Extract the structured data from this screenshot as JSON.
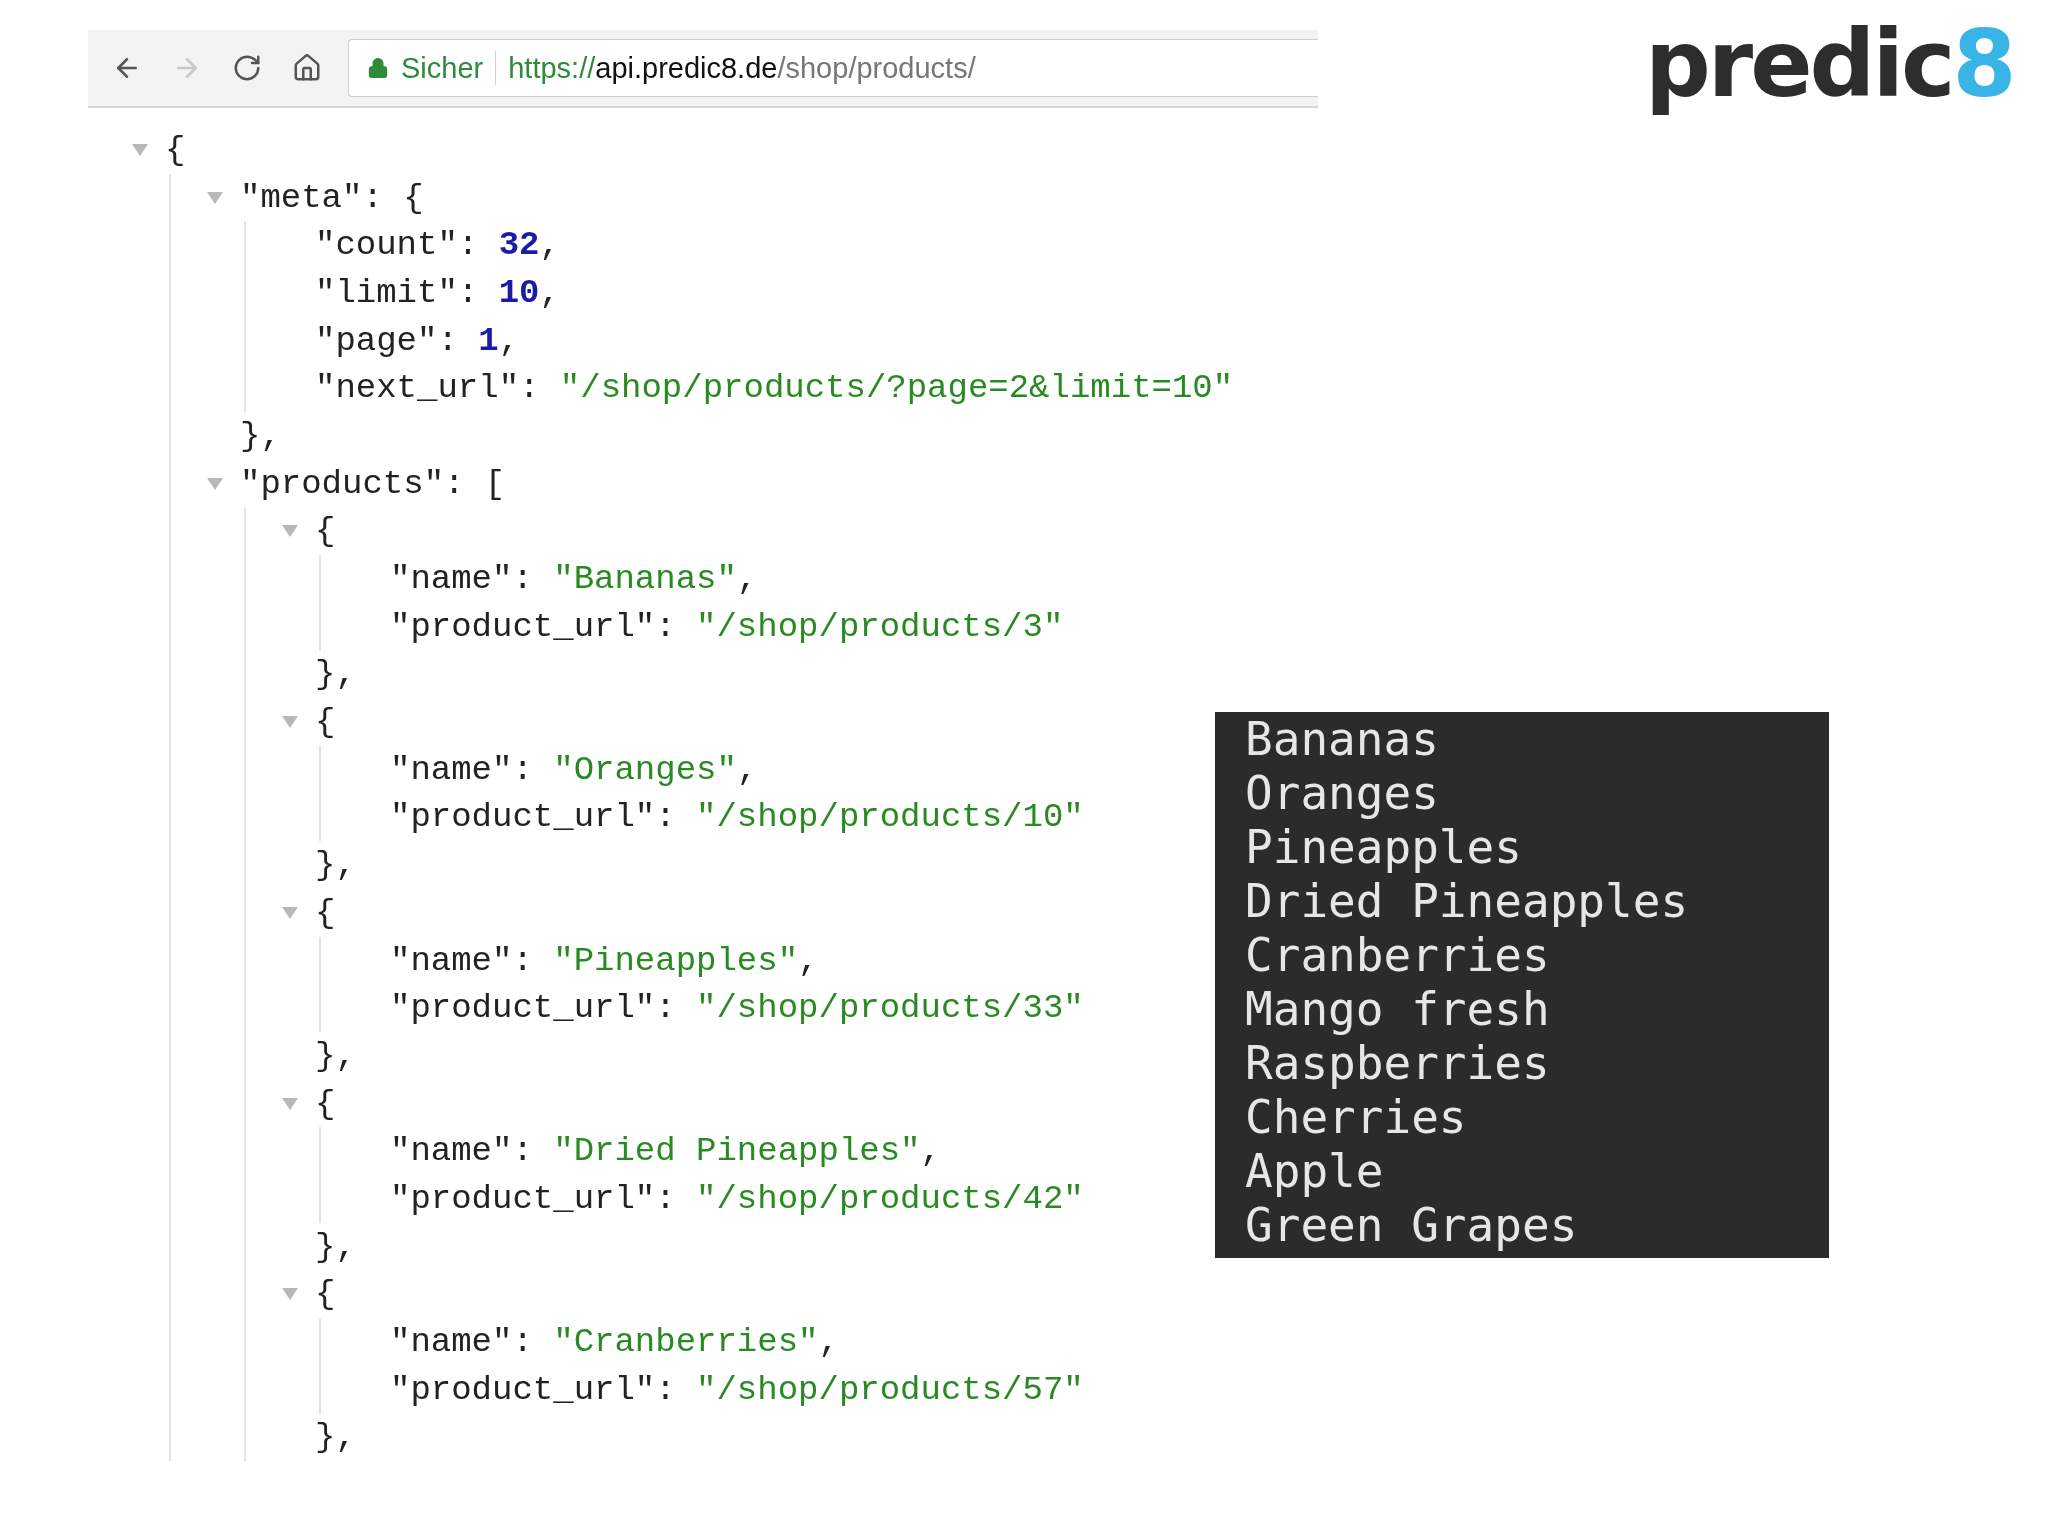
{
  "browser": {
    "nav": [
      {
        "kind": "back",
        "disabled": false
      },
      {
        "kind": "forward",
        "disabled": true
      },
      {
        "kind": "reload",
        "disabled": false
      },
      {
        "kind": "home",
        "disabled": false
      }
    ],
    "security_label": "Sicher",
    "url": {
      "scheme": "https://",
      "host": "api.predic8.de",
      "path": "/shop/products/"
    }
  },
  "json": {
    "open": "{",
    "expanded": true,
    "children": [
      {
        "key": "\"meta\": ",
        "open": "{",
        "close": "},",
        "expanded": true,
        "children": [
          {
            "key": "\"count\": ",
            "kind": "number",
            "value": "32",
            "after": ","
          },
          {
            "key": "\"limit\": ",
            "kind": "number",
            "value": "10",
            "after": ","
          },
          {
            "key": "\"page\": ",
            "kind": "number",
            "value": "1",
            "after": ","
          },
          {
            "key": "\"next_url\": ",
            "kind": "string",
            "value": "\"/shop/products/?page=2&limit=10\""
          }
        ]
      },
      {
        "key": "\"products\": ",
        "open": "[",
        "expanded": true,
        "children": [
          {
            "open": "{",
            "close": "},",
            "expanded": true,
            "children": [
              {
                "key": "\"name\": ",
                "kind": "string",
                "value": "\"Bananas\"",
                "after": ","
              },
              {
                "key": "\"product_url\": ",
                "kind": "string",
                "value": "\"/shop/products/3\""
              }
            ]
          },
          {
            "open": "{",
            "close": "},",
            "expanded": true,
            "children": [
              {
                "key": "\"name\": ",
                "kind": "string",
                "value": "\"Oranges\"",
                "after": ","
              },
              {
                "key": "\"product_url\": ",
                "kind": "string",
                "value": "\"/shop/products/10\""
              }
            ]
          },
          {
            "open": "{",
            "close": "},",
            "expanded": true,
            "children": [
              {
                "key": "\"name\": ",
                "kind": "string",
                "value": "\"Pineapples\"",
                "after": ","
              },
              {
                "key": "\"product_url\": ",
                "kind": "string",
                "value": "\"/shop/products/33\""
              }
            ]
          },
          {
            "open": "{",
            "close": "},",
            "expanded": true,
            "children": [
              {
                "key": "\"name\": ",
                "kind": "string",
                "value": "\"Dried Pineapples\"",
                "after": ","
              },
              {
                "key": "\"product_url\": ",
                "kind": "string",
                "value": "\"/shop/products/42\""
              }
            ]
          },
          {
            "open": "{",
            "close": "},",
            "expanded": true,
            "children": [
              {
                "key": "\"name\": ",
                "kind": "string",
                "value": "\"Cranberries\"",
                "after": ","
              },
              {
                "key": "\"product_url\": ",
                "kind": "string",
                "value": "\"/shop/products/57\""
              }
            ]
          }
        ]
      }
    ]
  },
  "logo": {
    "text": "predic",
    "accent": "8"
  },
  "terminal": {
    "lines": [
      "Bananas",
      "Oranges",
      "Pineapples",
      "Dried Pineapples",
      "Cranberries",
      "Mango fresh",
      "Raspberries",
      "Cherries",
      "Apple",
      "Green Grapes"
    ]
  }
}
